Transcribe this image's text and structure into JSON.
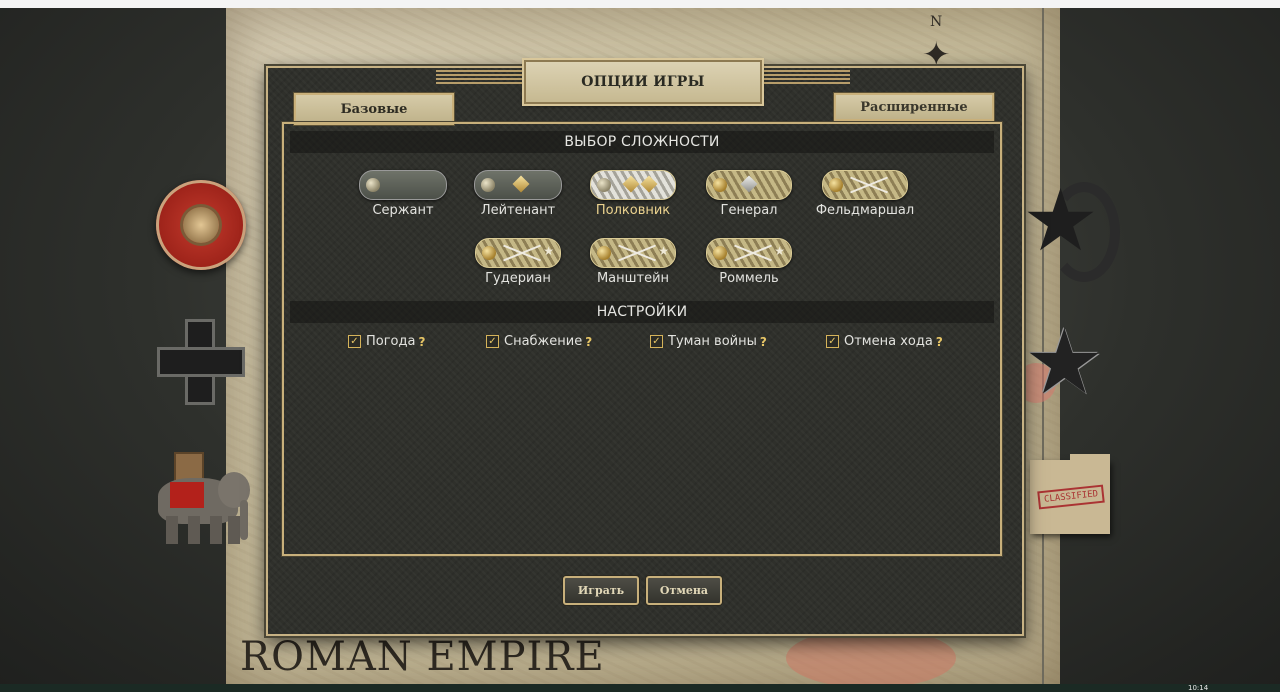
{
  "map": {
    "title": "ROMAN EMPIRE",
    "compass_letter": "N"
  },
  "dialog": {
    "title": "ОПЦИИ ИГРЫ",
    "tabs": [
      {
        "label": "Базовые",
        "active": true
      },
      {
        "label": "Расширенные",
        "active": false
      }
    ],
    "difficulty_header": "ВЫБОР СЛОЖНОСТИ",
    "selected_rank": "Полковник",
    "ranks": [
      {
        "label": "Сержант",
        "insignia": "plain-strap-icon"
      },
      {
        "label": "Лейтенант",
        "insignia": "plain-strap-one-pip-icon"
      },
      {
        "label": "Полковник",
        "insignia": "silver-braid-two-pip-icon"
      },
      {
        "label": "Генерал",
        "insignia": "braid-one-pip-icon"
      },
      {
        "label": "Фельдмаршал",
        "insignia": "braid-crossed-batons-icon"
      },
      {
        "label": "Гудериан",
        "insignia": "braid-batons-star-icon"
      },
      {
        "label": "Манштейн",
        "insignia": "braid-batons-star-icon"
      },
      {
        "label": "Роммель",
        "insignia": "braid-batons-star-icon"
      }
    ],
    "settings_header": "НАСТРОЙКИ",
    "settings": [
      {
        "label": "Погода",
        "checked": true,
        "help": "?"
      },
      {
        "label": "Снабжение",
        "checked": true,
        "help": "?"
      },
      {
        "label": "Туман войны",
        "checked": true,
        "help": "?"
      },
      {
        "label": "Отмена хода",
        "checked": true,
        "help": "?"
      }
    ],
    "buttons": {
      "play": "Играть",
      "cancel": "Отмена"
    }
  },
  "side_icons": {
    "left": [
      "roman-shield-icon",
      "iron-cross-icon",
      "war-elephant-icon"
    ],
    "right": [
      "soviet-star-icon",
      "us-star-icon",
      "classified-folder-icon"
    ],
    "folder_stamp": "CLASSIFIED"
  },
  "taskbar": {
    "clock": "10:14"
  },
  "colors": {
    "accent_gold": "#c8b07b",
    "panel": "#2f302b",
    "active_text": "#ecd38f"
  }
}
